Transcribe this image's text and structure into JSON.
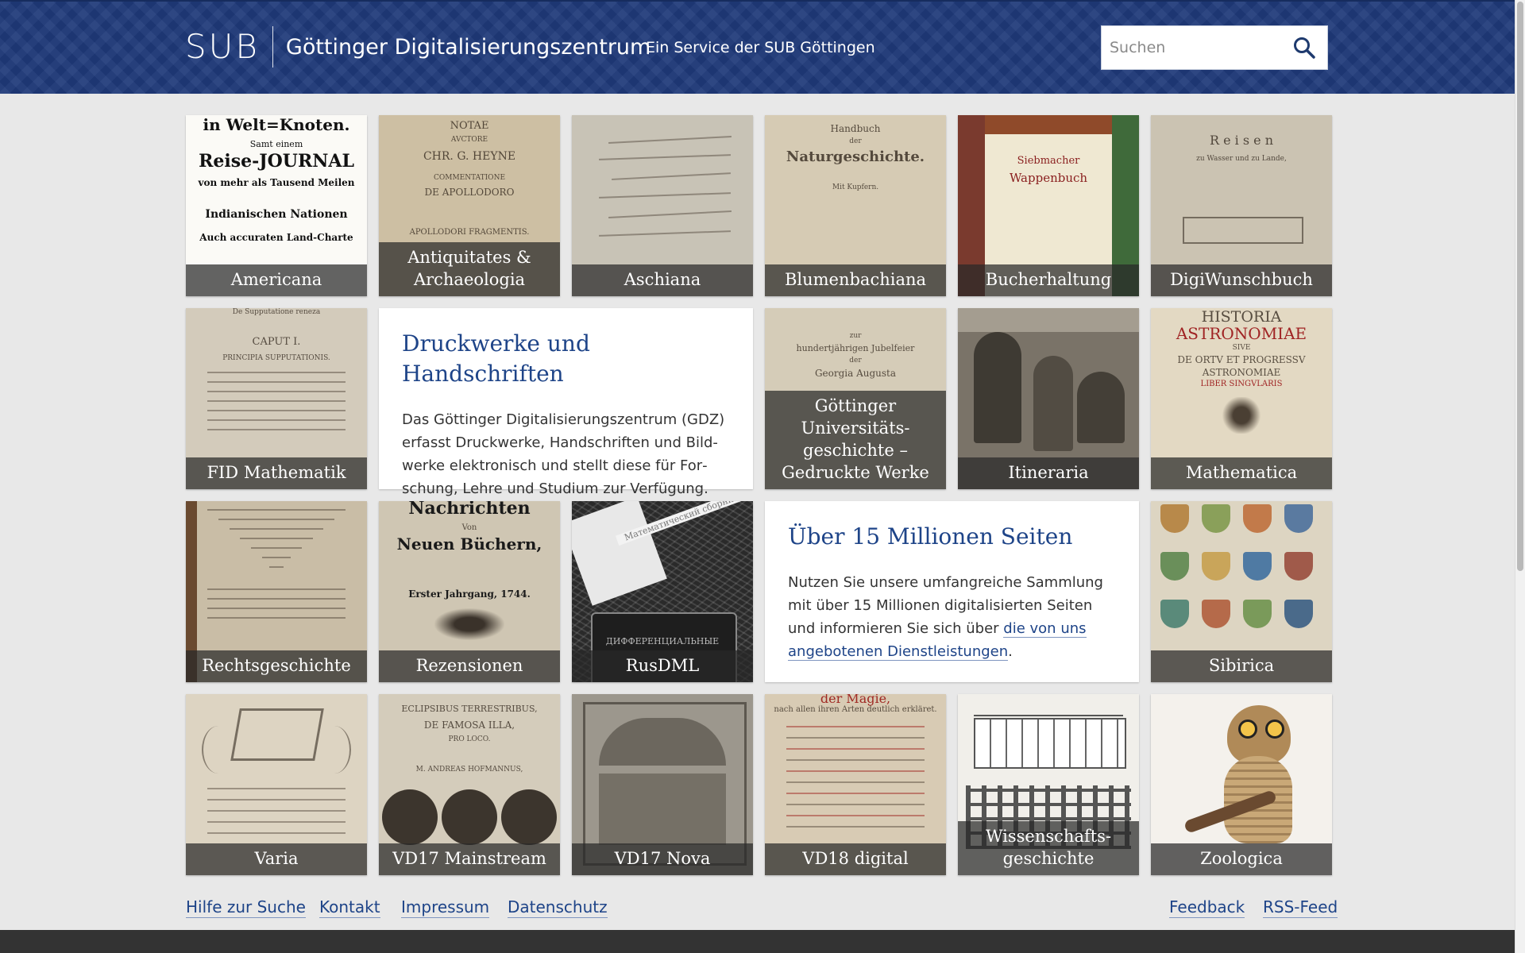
{
  "header": {
    "logo_mark": "SUB",
    "title": "Göttinger Digitalisierungszentrum",
    "service": "Ein Service der SUB Göttingen",
    "search_placeholder": "Suchen",
    "search_icon": "search-icon"
  },
  "collections": [
    "Americana",
    "Antiquitates & Archaeologia",
    "Aschiana",
    "Blumenbachiana",
    "Bucherhaltung",
    "DigiWunschbuch",
    "FID Mathematik",
    "Göttinger Universitäts-geschichte – Gedruckte Werke",
    "Itineraria",
    "Mathematica",
    "Rechtsgeschichte",
    "Rezensionen",
    "RusDML",
    "Sibirica",
    "Varia",
    "VD17 Mainstream",
    "VD17 Nova",
    "VD18 digital",
    "Wissenschafts-geschichte",
    "Zoologica"
  ],
  "thumb_text": {
    "americana": [
      "in Welt=Knoten.",
      "Samt einem",
      "Reise-JOURNAL",
      "von mehr als Tausend Meilen",
      "Indianischen Nationen",
      "Auch accuraten Land-Charte"
    ],
    "antiquitates": [
      "NOTAE",
      "AVCTORE",
      "CHR. G. HEYNE",
      "COMMENTATIONE",
      "DE APOLLODORO",
      "APOLLODORI FRAGMENTIS."
    ],
    "blumenbachiana": [
      "Handbuch",
      "der",
      "Naturgeschichte.",
      "Mit Kupfern."
    ],
    "bucherhaltung": [
      "Siebmacher",
      "Wappenbuch"
    ],
    "digiwunschbuch": [
      "R e i s e n",
      "zu Wasser und zu Lande,"
    ],
    "fid_mathematik": [
      "De Supputatione reneza",
      "CAPUT I.",
      "PRINCIPIA SUPPUTATIONIS."
    ],
    "universitaet": [
      "zur",
      "hundertjährigen Jubelfeier",
      "der",
      "Georgia Augusta"
    ],
    "mathematica": [
      "HISTORIA",
      "ASTRONOMIAE",
      "SIVE",
      "DE ORTV ET PROGRESSV",
      "ASTRONOMIAE",
      "LIBER SINGVLARIS"
    ],
    "rezensionen": [
      "Nachrichten",
      "Von",
      "Neuen Büchern,",
      "Erster Jahrgang, 1744."
    ],
    "rusdml": [
      "Математический сборник",
      "ДИФФЕРЕНЦИАЛЬНЫЕ"
    ],
    "vd17_mainstream": [
      "ECLIPSIBUS TERRESTRIBUS,",
      "DE FAMOSA ILLA,",
      "PRO LOCO.",
      "M. ANDREAS HOFMANNUS,"
    ],
    "vd18": [
      "der Magie,",
      "nach allen ihren Arten deutlich erkläret."
    ]
  },
  "info_boxes": [
    {
      "heading": "Druckwerke und Handschriften",
      "text": "Das Göttinger Digitalisierungszentrum (GDZ) erfasst Druckwerke, Handschriften und Bild­werke elektronisch und stellt diese für For­schung, Lehre und Studium zur Verfügung."
    },
    {
      "heading": "Über 15 Millionen Seiten",
      "text_before": "Nutzen Sie unsere umfangreiche Sammlung mit über 15 Millionen digitalisierten Seiten und informieren Sie sich über ",
      "link": "die von uns angebotenen Dienstleistungen",
      "text_after": "."
    }
  ],
  "footer": {
    "left": [
      "Hilfe zur Suche",
      "Kontakt",
      "Impressum",
      "Datenschutz"
    ],
    "right": [
      "Feedback",
      "RSS-Feed"
    ]
  },
  "colors": {
    "header": "#1f3a7a",
    "link": "#1e4488",
    "page_bg": "#e8e8e8",
    "footer_bar": "#333333"
  }
}
